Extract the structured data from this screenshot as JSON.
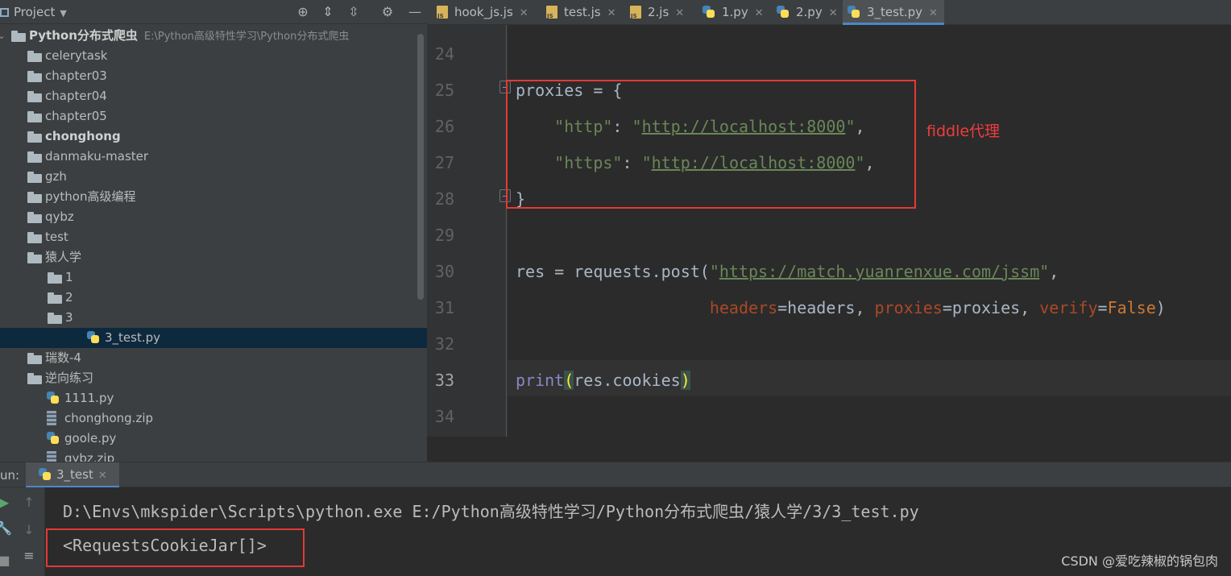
{
  "project": {
    "title": "Project",
    "tree": [
      {
        "label": "Python分布式爬虫",
        "path": "E:\\Python高级特性学习\\Python分布式爬虫",
        "type": "folder",
        "level": 0,
        "expanded": true,
        "bold": true
      },
      {
        "label": "celerytask",
        "type": "folder",
        "level": 1,
        "expanded": false
      },
      {
        "label": "chapter03",
        "type": "folder",
        "level": 1,
        "expanded": false
      },
      {
        "label": "chapter04",
        "type": "folder",
        "level": 1,
        "expanded": false
      },
      {
        "label": "chapter05",
        "type": "folder",
        "level": 1,
        "expanded": false
      },
      {
        "label": "chonghong",
        "type": "folder",
        "level": 1,
        "expanded": false,
        "bold": true
      },
      {
        "label": "danmaku-master",
        "type": "folder",
        "level": 1,
        "expanded": false
      },
      {
        "label": "gzh",
        "type": "folder",
        "level": 1,
        "expanded": false
      },
      {
        "label": "python高级编程",
        "type": "folder",
        "level": 1,
        "expanded": false
      },
      {
        "label": "qybz",
        "type": "folder",
        "level": 1,
        "expanded": false
      },
      {
        "label": "test",
        "type": "folder",
        "level": 1,
        "expanded": false
      },
      {
        "label": "猿人学",
        "type": "folder",
        "level": 1,
        "expanded": true
      },
      {
        "label": "1",
        "type": "folder",
        "level": 2,
        "expanded": false
      },
      {
        "label": "2",
        "type": "folder",
        "level": 2,
        "expanded": false
      },
      {
        "label": "3",
        "type": "folder",
        "level": 2,
        "expanded": true
      },
      {
        "label": "3_test.py",
        "type": "py",
        "level": 3,
        "selected": true
      },
      {
        "label": "瑞数-4",
        "type": "folder",
        "level": 1,
        "expanded": false
      },
      {
        "label": "逆向练习",
        "type": "folder",
        "level": 1,
        "expanded": false
      },
      {
        "label": "1111.py",
        "type": "py",
        "level": 1
      },
      {
        "label": "chonghong.zip",
        "type": "zip",
        "level": 1
      },
      {
        "label": "goole.py",
        "type": "py",
        "level": 1
      },
      {
        "label": "qybz.zip",
        "type": "zip",
        "level": 1
      }
    ]
  },
  "tabs": [
    {
      "label": "hook_js.js",
      "type": "js"
    },
    {
      "label": "test.js",
      "type": "js"
    },
    {
      "label": "2.js",
      "type": "js"
    },
    {
      "label": "1.py",
      "type": "py"
    },
    {
      "label": "2.py",
      "type": "py"
    },
    {
      "label": "3_test.py",
      "type": "py",
      "active": true
    }
  ],
  "editor": {
    "lines": [
      {
        "no": "24",
        "code": []
      },
      {
        "no": "25",
        "code": [
          [
            "plain",
            "proxies = {"
          ]
        ]
      },
      {
        "no": "26",
        "code": [
          [
            "plain",
            "    "
          ],
          [
            "str",
            "\"http\""
          ],
          [
            "plain",
            ": "
          ],
          [
            "str",
            "\""
          ],
          [
            "url",
            "http://localhost:8000"
          ],
          [
            "str",
            "\""
          ],
          [
            "plain",
            ","
          ]
        ]
      },
      {
        "no": "27",
        "code": [
          [
            "plain",
            "    "
          ],
          [
            "str",
            "\"https\""
          ],
          [
            "plain",
            ": "
          ],
          [
            "str",
            "\""
          ],
          [
            "url",
            "http://localhost:8000"
          ],
          [
            "str",
            "\""
          ],
          [
            "plain",
            ","
          ]
        ]
      },
      {
        "no": "28",
        "code": [
          [
            "plain",
            "}"
          ]
        ]
      },
      {
        "no": "29",
        "code": []
      },
      {
        "no": "30",
        "code": [
          [
            "plain",
            "res = requests.post("
          ],
          [
            "str",
            "\""
          ],
          [
            "url",
            "https://match.yuanrenxue.com/jssm"
          ],
          [
            "str",
            "\""
          ],
          [
            "plain",
            ","
          ]
        ]
      },
      {
        "no": "31",
        "code": [
          [
            "plain",
            "                    "
          ],
          [
            "kw",
            "headers"
          ],
          [
            "plain",
            "=headers, "
          ],
          [
            "kw",
            "proxies"
          ],
          [
            "plain",
            "=proxies, "
          ],
          [
            "kw",
            "verify"
          ],
          [
            "plain",
            "="
          ],
          [
            "const",
            "False"
          ],
          [
            "plain",
            ")"
          ]
        ]
      },
      {
        "no": "32",
        "code": []
      },
      {
        "no": "33",
        "code": [
          [
            "builtin",
            "print"
          ],
          [
            "paren",
            "("
          ],
          [
            "plain",
            "res.cookies"
          ],
          [
            "paren",
            ")"
          ]
        ],
        "current": true
      },
      {
        "no": "34",
        "code": []
      }
    ],
    "annotation": "fiddle代理"
  },
  "run": {
    "label": "un:",
    "tab": "3_test",
    "console": [
      "D:\\Envs\\mkspider\\Scripts\\python.exe E:/Python高级特性学习/Python分布式爬虫/猿人学/3/3_test.py",
      "<RequestsCookieJar[]>"
    ]
  },
  "watermark": "CSDN @爱吃辣椒的锅包肉",
  "colors": {
    "accent": "#4a88c7",
    "annotation_red": "#e53935",
    "string_green": "#6a8759",
    "keyword_orange": "#aa4926"
  }
}
